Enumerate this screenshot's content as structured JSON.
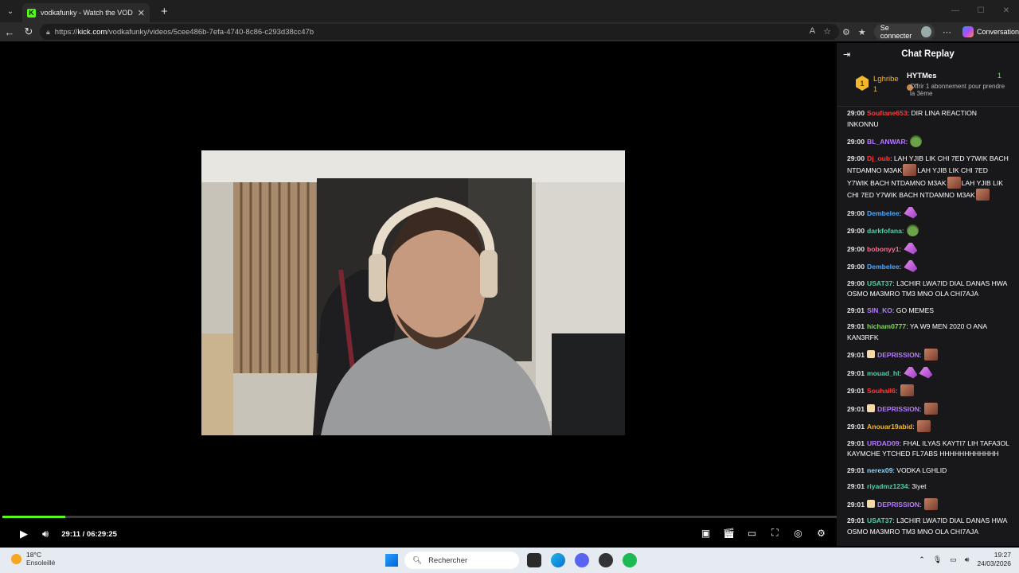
{
  "browser": {
    "tab_title": "vodkafunky - Watch the VOD on K",
    "url_prefix": "https://",
    "url_domain": "kick.com",
    "url_path": "/vodkafunky/videos/5cee486b-7efa-4740-8c86-c293d38cc47b",
    "signin_label": "Se connecter",
    "copilot_label": "Conversation"
  },
  "player": {
    "current_time": "29:11",
    "separator": "/",
    "duration": "06:29:25",
    "progress_fraction": 0.075,
    "accent_color": "#53fc18"
  },
  "chat": {
    "title": "Chat Replay",
    "pinned": {
      "rank": "1",
      "top_gifter": "Lghribe",
      "top_gifter_count": "1",
      "second_gifter": "HYTMes",
      "second_gifter_count": "1",
      "offer_text": "Offrir 1 abonnement pour prendre la 3ème"
    },
    "messages": [
      {
        "ts": "29:00",
        "user": "Soufiane653",
        "color": "#ff3b3b",
        "text": "DIR LINA REACTION INKONNU",
        "emotes": []
      },
      {
        "ts": "29:00",
        "user": "BL_ANWAR",
        "color": "#b57bff",
        "text": "",
        "emotes": [
          "pepe"
        ]
      },
      {
        "ts": "29:00",
        "user": "Dj_oub",
        "color": "#ff3b3b",
        "text": "LAH YJIB LIK CHI 7ED Y7WIK BACH NTDAMNO M3AK",
        "text2": "LAH YJIB LIK CHI 7ED Y7WIK BACH NTDAMNO M3AK",
        "text3": "LAH YJIB LIK CHI 7ED Y7WIK BACH NTDAMNO M3AK",
        "emotes": []
      },
      {
        "ts": "29:00",
        "user": "Dembelee",
        "color": "#4aa8ff",
        "text": "",
        "emotes": [
          "pink"
        ]
      },
      {
        "ts": "29:00",
        "user": "darkfofana",
        "color": "#4fd1a5",
        "text": "",
        "emotes": [
          "pepe"
        ]
      },
      {
        "ts": "29:00",
        "user": "bobonyy1",
        "color": "#ff6b8a",
        "text": "",
        "emotes": [
          "pink"
        ]
      },
      {
        "ts": "29:00",
        "user": "Dembelee",
        "color": "#4aa8ff",
        "text": "",
        "emotes": [
          "pink"
        ]
      },
      {
        "ts": "29:00",
        "user": "USAT37",
        "color": "#4fd1a5",
        "text": "L3CHIR LWA7ID DIAL DANAS HWA OSMO MA3MRO TM3 MNO OLA CHI7AJA",
        "emotes": []
      },
      {
        "ts": "29:01",
        "user": "SIN_KO",
        "color": "#b57bff",
        "text": "GO MEMES",
        "emotes": []
      },
      {
        "ts": "29:01",
        "user": "hicham0777",
        "color": "#7ddc5a",
        "text": "YA W9 MEN 2020 O ANA KAN3RFK",
        "emotes": []
      },
      {
        "ts": "29:01",
        "user": "DEPRISSION",
        "color": "#b57bff",
        "text": "",
        "emotes": [
          "face"
        ],
        "gift_badge": true
      },
      {
        "ts": "29:01",
        "user": "mouad_hl",
        "color": "#4fd1a5",
        "text": "",
        "emotes": [
          "pink",
          "pink"
        ]
      },
      {
        "ts": "29:01",
        "user": "Souhail6",
        "color": "#ff3b3b",
        "text": "",
        "emotes": [
          "face"
        ]
      },
      {
        "ts": "29:01",
        "user": "DEPRISSION",
        "color": "#b57bff",
        "text": "",
        "emotes": [
          "face"
        ],
        "gift_badge": true
      },
      {
        "ts": "29:01",
        "user": "Anouar19abid",
        "color": "#f5b72b",
        "text": "",
        "emotes": [
          "face"
        ]
      },
      {
        "ts": "29:01",
        "user": "URDAD09",
        "color": "#b57bff",
        "text": "FHAL ILYAS KAYTI7 LIH TAFA3OL KAYMCHE YTCHED FL7ABS HHHHHHHHHHHH",
        "emotes": []
      },
      {
        "ts": "29:01",
        "user": "nerex09",
        "color": "#7fd8ff",
        "text": "VODKA LGHLID",
        "emotes": []
      },
      {
        "ts": "29:01",
        "user": "riyadmz1234",
        "color": "#4fd1a5",
        "text": "3iyet",
        "emotes": []
      },
      {
        "ts": "29:01",
        "user": "DEPRISSION",
        "color": "#b57bff",
        "text": "",
        "emotes": [
          "face"
        ],
        "gift_badge": true
      },
      {
        "ts": "29:01",
        "user": "USAT37",
        "color": "#4fd1a5",
        "text": "L3CHIR LWA7ID DIAL DANAS HWA OSMO MA3MRO TM3 MNO OLA CHI7AJA",
        "emotes": []
      }
    ]
  },
  "taskbar": {
    "temperature": "18°C",
    "weather": "Ensoleillé",
    "search_placeholder": "Rechercher",
    "time": "19:27",
    "date": "24/03/2026"
  }
}
